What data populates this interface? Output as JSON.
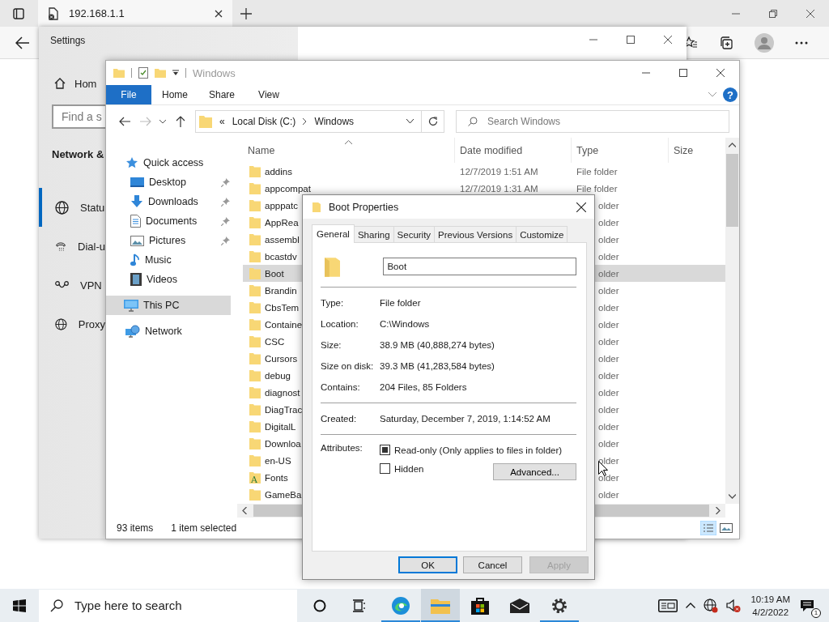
{
  "browser": {
    "tab": {
      "title": "192.168.1.1"
    }
  },
  "settings": {
    "title": "Settings",
    "home": "Hom",
    "search": {
      "placeholder": "Find a s"
    },
    "heading": "Network &",
    "items": [
      {
        "label": "Statu",
        "kind": "status",
        "selected": true
      },
      {
        "label": "Dial-u",
        "kind": "dialup",
        "selected": false
      },
      {
        "label": "VPN",
        "kind": "vpn",
        "selected": false
      },
      {
        "label": "Proxy",
        "kind": "proxy",
        "selected": false
      }
    ]
  },
  "explorer": {
    "title": "Windows",
    "ribbon_tabs": [
      {
        "label": "File",
        "kind": "file"
      },
      {
        "label": "Home",
        "kind": "tab"
      },
      {
        "label": "Share",
        "kind": "tab"
      },
      {
        "label": "View",
        "kind": "tab"
      }
    ],
    "address": {
      "overflow": "«",
      "crumbs": [
        "Local Disk (C:)",
        "Windows"
      ]
    },
    "search": {
      "placeholder": "Search Windows"
    },
    "help": "?",
    "nav": [
      {
        "label": "Quick access",
        "kind": "star",
        "selected": false,
        "children": [
          {
            "label": "Desktop",
            "kind": "desktop",
            "pinned": true,
            "selected": false
          },
          {
            "label": "Downloads",
            "kind": "downloads",
            "pinned": true,
            "selected": false
          },
          {
            "label": "Documents",
            "kind": "documents",
            "pinned": true,
            "selected": false
          },
          {
            "label": "Pictures",
            "kind": "pictures",
            "pinned": true,
            "selected": false
          },
          {
            "label": "Music",
            "kind": "music",
            "pinned": false,
            "selected": false
          },
          {
            "label": "Videos",
            "kind": "videos",
            "pinned": false,
            "selected": false
          }
        ]
      },
      {
        "label": "This PC",
        "kind": "pc",
        "selected": true
      },
      {
        "label": "Network",
        "kind": "network",
        "selected": false
      }
    ],
    "columns": [
      "Name",
      "Date modified",
      "Type",
      "Size"
    ],
    "rows": [
      {
        "name": "addins",
        "date": "12/7/2019 1:51 AM",
        "type": "File folder",
        "kind": "folder",
        "selected": false
      },
      {
        "name": "appcompat",
        "date": "12/7/2019 1:31 AM",
        "type": "File folder",
        "kind": "folder",
        "selected": false
      },
      {
        "name": "apppatc",
        "type": "older",
        "kind": "folder",
        "selected": false
      },
      {
        "name": "AppRea",
        "type": "older",
        "kind": "folder",
        "selected": false
      },
      {
        "name": "assembl",
        "type": "older",
        "kind": "folder",
        "selected": false
      },
      {
        "name": "bcastdv",
        "type": "older",
        "kind": "folder",
        "selected": false
      },
      {
        "name": "Boot",
        "type": "older",
        "kind": "folder",
        "selected": true
      },
      {
        "name": "Brandin",
        "type": "older",
        "kind": "folder",
        "selected": false
      },
      {
        "name": "CbsTem",
        "type": "older",
        "kind": "folder",
        "selected": false
      },
      {
        "name": "Containe",
        "type": "older",
        "kind": "folder",
        "selected": false
      },
      {
        "name": "CSC",
        "type": "older",
        "kind": "folder",
        "selected": false
      },
      {
        "name": "Cursors",
        "type": "older",
        "kind": "folder",
        "selected": false
      },
      {
        "name": "debug",
        "type": "older",
        "kind": "folder",
        "selected": false
      },
      {
        "name": "diagnost",
        "type": "older",
        "kind": "folder",
        "selected": false
      },
      {
        "name": "DiagTrac",
        "type": "older",
        "kind": "folder",
        "selected": false
      },
      {
        "name": "DigitalL",
        "type": "older",
        "kind": "folder",
        "selected": false
      },
      {
        "name": "Downloa",
        "type": "older",
        "kind": "folder",
        "selected": false
      },
      {
        "name": "en-US",
        "type": "older",
        "kind": "folder",
        "selected": false
      },
      {
        "name": "Fonts",
        "type": "older",
        "kind": "font",
        "icon_letter": "A",
        "selected": false
      },
      {
        "name": "GameBa",
        "type": "older",
        "kind": "folder",
        "selected": false
      }
    ],
    "status": {
      "count": "93 items",
      "selection": "1 item selected"
    }
  },
  "dialog": {
    "title": "Boot Properties",
    "tabs": [
      {
        "label": "General",
        "selected": true
      },
      {
        "label": "Sharing",
        "selected": false
      },
      {
        "label": "Security",
        "selected": false
      },
      {
        "label": "Previous Versions",
        "selected": false
      },
      {
        "label": "Customize",
        "selected": false
      }
    ],
    "name_field": {
      "value": "Boot"
    },
    "groups": [
      [
        {
          "label": "Type:",
          "value": "File folder"
        },
        {
          "label": "Location:",
          "value": "C:\\Windows"
        },
        {
          "label": "Size:",
          "value": "38.9 MB (40,888,274 bytes)"
        },
        {
          "label": "Size on disk:",
          "value": "39.3 MB (41,283,584 bytes)"
        },
        {
          "label": "Contains:",
          "value": "204 Files, 85 Folders"
        }
      ],
      [
        {
          "label": "Created:",
          "value": "Saturday, December 7, 2019, 1:14:52 AM"
        }
      ]
    ],
    "attributes": {
      "label": "Attributes:",
      "options": [
        {
          "label": "Read-only (Only applies to files in folder)",
          "checked": true
        },
        {
          "label": "Hidden",
          "checked": false
        }
      ],
      "advanced": "Advanced..."
    },
    "buttons": [
      {
        "label": "OK",
        "kind": "default",
        "disabled": false
      },
      {
        "label": "Cancel",
        "kind": "normal",
        "disabled": false
      },
      {
        "label": "Apply",
        "kind": "normal",
        "disabled": true
      }
    ]
  },
  "taskbar": {
    "search": {
      "placeholder": "Type here to search"
    },
    "apps": [
      {
        "kind": "edge",
        "running": true,
        "active": false
      },
      {
        "kind": "explorer",
        "running": true,
        "active": true
      },
      {
        "kind": "store",
        "running": false,
        "active": false
      },
      {
        "kind": "mail",
        "running": false,
        "active": false
      },
      {
        "kind": "settings",
        "running": true,
        "active": false
      }
    ],
    "time": "10:19 AM",
    "date": "4/2/2022",
    "notifications": "1"
  }
}
